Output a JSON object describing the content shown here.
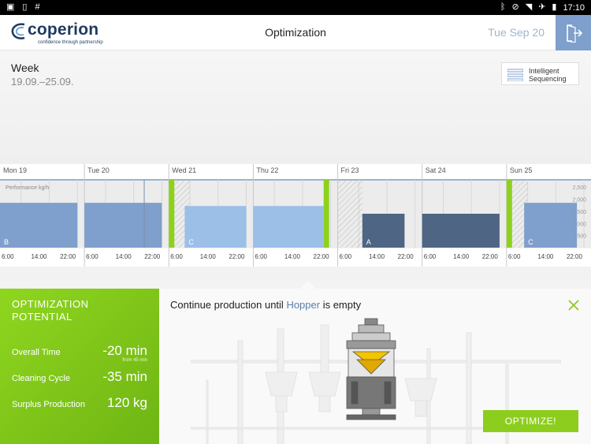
{
  "statusbar": {
    "left_icons": [
      "image-icon",
      "phone-icon",
      "hash-icon"
    ],
    "left_glyphs": [
      "▣",
      "▯",
      "#"
    ],
    "right_icons": [
      "bluetooth-icon",
      "dnd-icon",
      "wifi-icon",
      "airplane-icon",
      "battery-icon"
    ],
    "right_glyphs": [
      "ᛒ",
      "⊘",
      "◥",
      "✈",
      "▮"
    ],
    "time": "17:10"
  },
  "header": {
    "logo_name": "coperion",
    "logo_tagline": "confidence through partnership",
    "title": "Optimization",
    "date": "Tue Sep 20"
  },
  "week": {
    "label": "Week",
    "range": "19.09.–25.09."
  },
  "intelligent_sequencing": {
    "line1": "Intelligent",
    "line2": "Sequencing"
  },
  "timeline": {
    "days": [
      "Mon 19",
      "Tue 20",
      "Wed 21",
      "Thu 22",
      "Fri 23",
      "Sat 24",
      "Sun 25"
    ],
    "chart_label": "Performance kg/h",
    "y_ticks": [
      "2,500",
      "2,000",
      "1,500",
      "1,000",
      "500"
    ],
    "hour_ticks": [
      "6:00",
      "14:00",
      "22:00"
    ],
    "bars": [
      {
        "day": 0,
        "start_h": 0,
        "end_h": 22,
        "perf": 1850,
        "label": "B",
        "color": "#7f9fcc"
      },
      {
        "day": 1,
        "start_h": 0,
        "end_h": 22,
        "perf": 1850,
        "label": "",
        "color": "#7f9fcc"
      },
      {
        "day": 2,
        "start_h": 4.5,
        "end_h": 22,
        "perf": 1720,
        "label": "C",
        "color": "#9cbfe8"
      },
      {
        "day": 3,
        "start_h": 0,
        "end_h": 20,
        "perf": 1720,
        "label": "",
        "color": "#9cbfe8"
      },
      {
        "day": 4,
        "start_h": 7,
        "end_h": 19,
        "perf": 1400,
        "label": "A",
        "color": "#4f6584"
      },
      {
        "day": 5,
        "start_h": 0,
        "end_h": 22,
        "perf": 1400,
        "label": "",
        "color": "#4f6584"
      },
      {
        "day": 6,
        "start_h": 5,
        "end_h": 20,
        "perf": 1850,
        "label": "C",
        "color": "#7f9fcc"
      }
    ],
    "hatches": [
      {
        "day": 2,
        "start_h": 1,
        "end_h": 6
      },
      {
        "day": 4,
        "start_h": 0,
        "end_h": 7
      },
      {
        "day": 6,
        "start_h": 1,
        "end_h": 6
      }
    ],
    "green_marks": [
      {
        "day": 2,
        "hour": 0
      },
      {
        "day": 3,
        "hour": 20
      },
      {
        "day": 6,
        "hour": 0
      }
    ],
    "colors": {
      "green": "#8dd11d",
      "grid": "#c8c8c8",
      "blue_line": "#7f9fcc"
    }
  },
  "optimization": {
    "title_line1": "OPTIMIZATION",
    "title_line2": "POTENTIAL",
    "overall_time_label": "Overall Time",
    "overall_time_value": "-20 min",
    "overall_time_sub": "from 45 min",
    "cleaning_label": "Cleaning Cycle",
    "cleaning_value": "-35 min",
    "surplus_label": "Surplus Production",
    "surplus_value": "120 kg"
  },
  "info": {
    "text_before": "Continue production until ",
    "text_highlight": "Hopper",
    "text_after": " is empty",
    "button": "OPTIMIZE!"
  },
  "colors": {
    "accent_green": "#8dcd1e",
    "brand_blue": "#1f3a5f",
    "bar_blue": "#7f9fcc"
  }
}
